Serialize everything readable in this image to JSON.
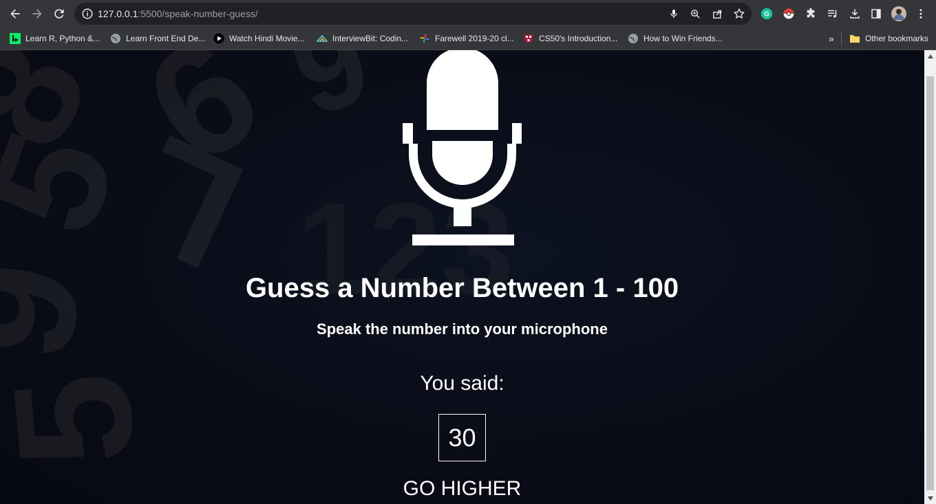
{
  "browser": {
    "url_host": "127.0.0.1",
    "url_path": ":5500/speak-number-guess/",
    "bookmarks": [
      {
        "label": "Learn R, Python &...",
        "icon": "datacamp-icon",
        "color": "#03ef62"
      },
      {
        "label": "Learn Front End De...",
        "icon": "globe-icon",
        "color": "#9aa0a6"
      },
      {
        "label": "Watch Hindi Movie...",
        "icon": "play-circle-icon",
        "color": "#000000"
      },
      {
        "label": "InterviewBit: Codin...",
        "icon": "interviewbit-icon",
        "color": "#5ad0c6"
      },
      {
        "label": "Farewell 2019-20 cl...",
        "icon": "pinwheel-icon",
        "color": "#fbbc04"
      },
      {
        "label": "CS50's Introduction...",
        "icon": "harvard-shield-icon",
        "color": "#a51c30"
      },
      {
        "label": "How to Win Friends...",
        "icon": "globe-icon",
        "color": "#9aa0a6"
      }
    ],
    "overflow_label": "»",
    "other_bookmarks": "Other bookmarks"
  },
  "page": {
    "title": "Guess a Number Between 1 - 100",
    "subtitle": "Speak the number into your microphone",
    "you_said_label": "You said:",
    "guess_value": "30",
    "hint": "GO HIGHER",
    "background_color": "#0a0d18",
    "text_color": "#ffffff"
  }
}
